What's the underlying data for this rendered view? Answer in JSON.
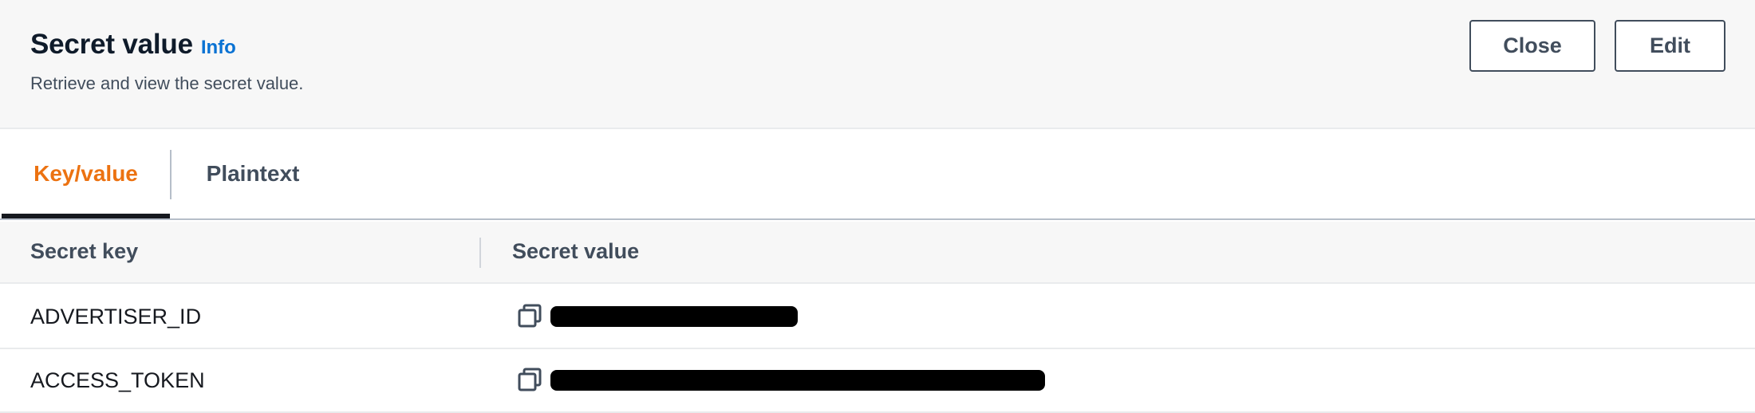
{
  "header": {
    "title": "Secret value",
    "info_link": "Info",
    "description": "Retrieve and view the secret value.",
    "close_label": "Close",
    "edit_label": "Edit"
  },
  "tabs": [
    {
      "label": "Key/value",
      "active": true
    },
    {
      "label": "Plaintext",
      "active": false
    }
  ],
  "table": {
    "columns": [
      "Secret key",
      "Secret value"
    ],
    "rows": [
      {
        "key": "ADVERTISER_ID",
        "value": "",
        "value_redacted": true
      },
      {
        "key": "ACCESS_TOKEN",
        "value": "",
        "value_redacted": true
      }
    ]
  },
  "icons": {
    "copy": "copy-icon"
  },
  "colors": {
    "header_bg": "#f7f7f7",
    "accent_active_tab": "#ec7211",
    "info_link": "#0972d3",
    "button_border": "#414d5c"
  }
}
